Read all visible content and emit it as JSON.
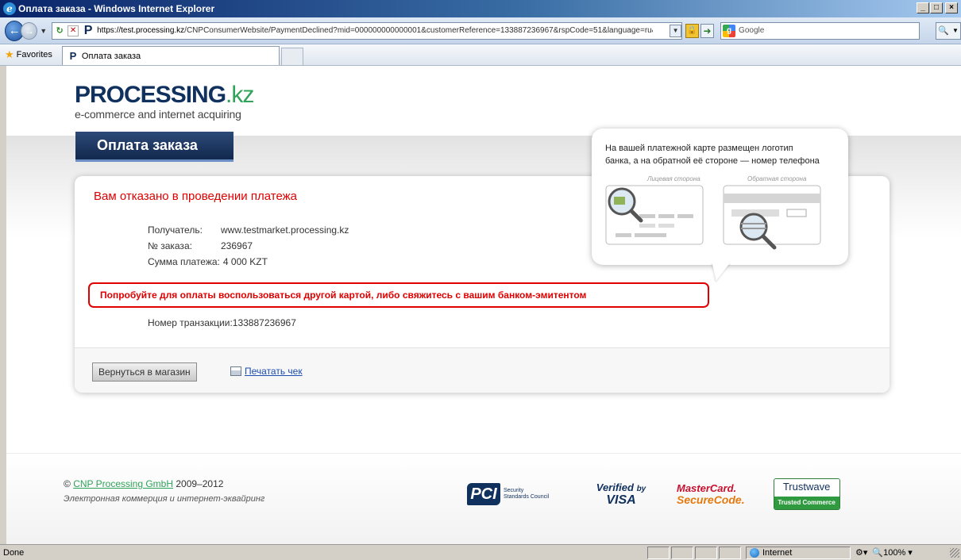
{
  "window": {
    "title": "Оплата заказа - Windows Internet Explorer",
    "minimize": "_",
    "maximize": "□",
    "close": "×"
  },
  "browser": {
    "url_host": "https://test.processing.kz",
    "url_path": "/CNPConsumerWebsite/PaymentDeclined?mid=000000000000001&customerReference=133887236967&rspCode=51&language=ru&l",
    "search_placeholder": "Google",
    "favorites_label": "Favorites",
    "tab_title": "Оплата заказа"
  },
  "page": {
    "brand_main": "PROCESSING",
    "brand_suffix": ".kz",
    "brand_tagline": "e-commerce and internet acquiring",
    "section_title": "Оплата заказа",
    "decline_heading": "Вам отказано в проведении платежа",
    "fields": [
      {
        "label": "Получатель:",
        "value": "www.testmarket.processing.kz"
      },
      {
        "label": "№ заказа:",
        "value": "236967"
      },
      {
        "label": "Сумма платежа:",
        "value": "4 000 KZT"
      }
    ],
    "alert_text": "Попробуйте для оплаты воспользоваться другой картой, либо свяжитесь с вашим банком-эмитентом",
    "transaction_label": "Номер транзакции:",
    "transaction_value": "133887236967",
    "back_button": "Вернуться в магазин",
    "print_link": "Печатать чек",
    "tip_line1": "На вашей платежной карте размещен логотип",
    "tip_line2": "банка, а на обратной её стороне — номер телефона",
    "card_front_label": "Лицевая сторона",
    "card_back_label": "Обратная сторона"
  },
  "footer": {
    "copyright_symbol": "©",
    "company_link": "CNP Processing GmbH",
    "years": "2009–2012",
    "slogan": "Электронная коммерция и интернет-эквайринг",
    "pci_mark": "PCI",
    "pci_line1": "Security",
    "pci_line2": "Standards Council",
    "vbv_line1": "Verified",
    "vbv_by": "by",
    "vbv_line2": "VISA",
    "mc_line1": "MasterCard.",
    "mc_line2": "SecureCode.",
    "tw_line1": "Trustwave",
    "tw_line2": "Trusted Commerce"
  },
  "status": {
    "text": "Done",
    "zone": "Internet",
    "zoom": "100%"
  },
  "colors": {
    "brand_navy": "#10305e",
    "brand_green": "#2fa35a",
    "error_red": "#e00000",
    "link_blue": "#1d4fb0"
  }
}
